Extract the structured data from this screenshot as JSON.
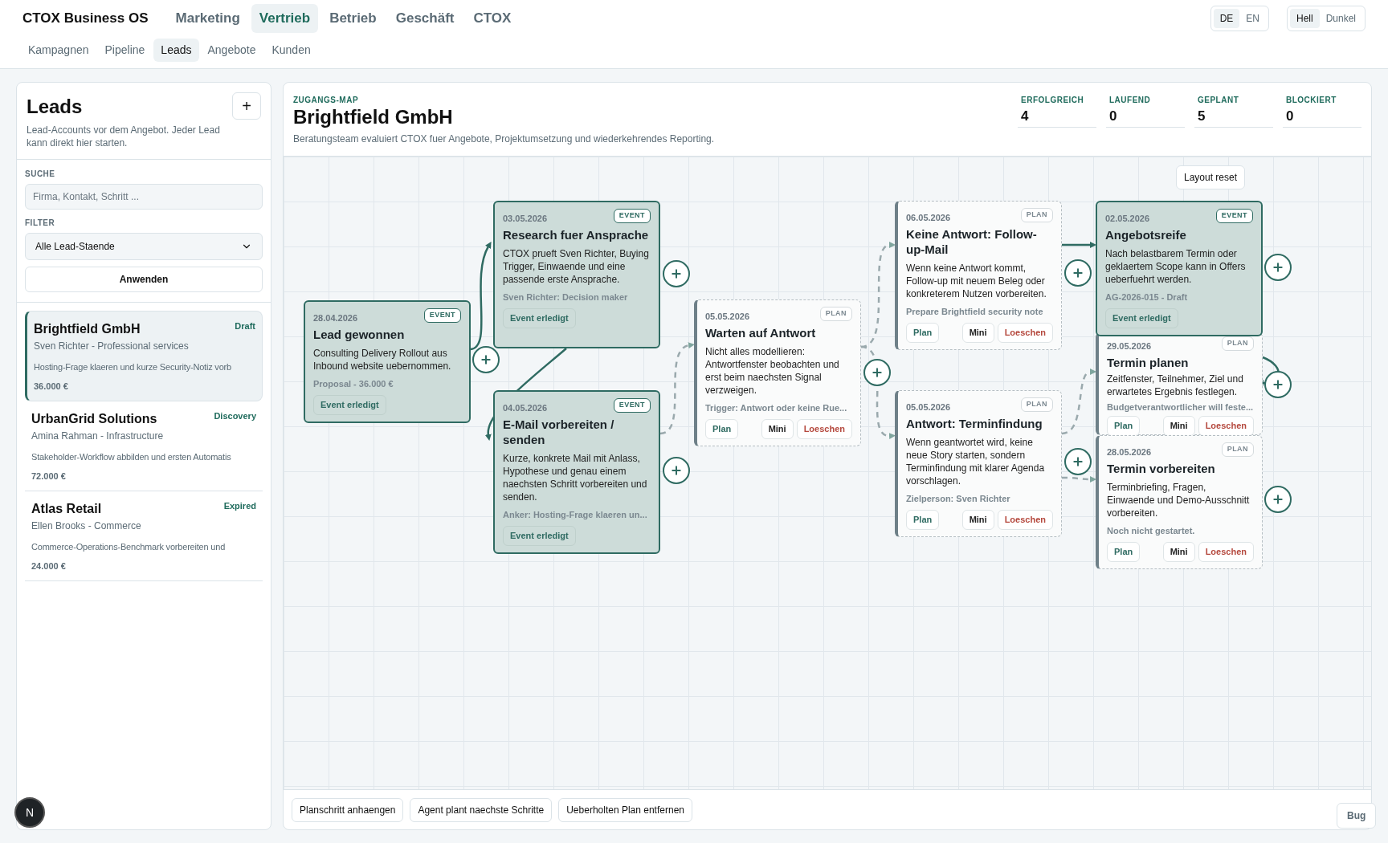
{
  "brand": "CTOX Business OS",
  "main_nav": [
    {
      "label": "Marketing",
      "selected": false
    },
    {
      "label": "Vertrieb",
      "selected": true
    },
    {
      "label": "Betrieb",
      "selected": false
    },
    {
      "label": "Geschäft",
      "selected": false
    },
    {
      "label": "CTOX",
      "selected": false
    }
  ],
  "sub_nav": [
    {
      "label": "Kampagnen",
      "selected": false
    },
    {
      "label": "Pipeline",
      "selected": false
    },
    {
      "label": "Leads",
      "selected": true
    },
    {
      "label": "Angebote",
      "selected": false
    },
    {
      "label": "Kunden",
      "selected": false
    }
  ],
  "language": [
    {
      "label": "DE",
      "selected": true
    },
    {
      "label": "EN",
      "selected": false
    }
  ],
  "theme": [
    {
      "label": "Hell",
      "selected": true
    },
    {
      "label": "Dunkel",
      "selected": false
    }
  ],
  "sidebar": {
    "title": "Leads",
    "add_button": "+",
    "subtitle": "Lead-Accounts vor dem Angebot. Jeder Lead kann direkt hier starten.",
    "search_label": "SUCHE",
    "search_placeholder": "Firma, Kontakt, Schritt ...",
    "filter_label": "FILTER",
    "filter_value": "Alle Lead-Staende",
    "apply_button": "Anwenden",
    "leads": [
      {
        "name": "Brightfield GmbH",
        "status": "Draft",
        "contact": "Sven Richter - Professional services",
        "next_step": "Hosting-Frage klaeren und kurze Security-Notiz vorb",
        "value": "36.000 €",
        "selected": true
      },
      {
        "name": "UrbanGrid Solutions",
        "status": "Discovery",
        "contact": "Amina Rahman - Infrastructure",
        "next_step": "Stakeholder-Workflow abbilden und ersten Automatis",
        "value": "72.000 €",
        "selected": false
      },
      {
        "name": "Atlas Retail",
        "status": "Expired",
        "contact": "Ellen Brooks - Commerce",
        "next_step": "Commerce-Operations-Benchmark vorbereiten und",
        "value": "24.000 €",
        "selected": false
      }
    ]
  },
  "map": {
    "eyebrow": "ZUGANGS-MAP",
    "title": "Brightfield GmbH",
    "description": "Beratungsteam evaluiert CTOX fuer Angebote, Projektumsetzung und wiederkehrendes Reporting.",
    "stats": [
      {
        "label": "ERFOLGREICH",
        "value": "4"
      },
      {
        "label": "LAUFEND",
        "value": "0"
      },
      {
        "label": "GEPLANT",
        "value": "5"
      },
      {
        "label": "BLOCKIERT",
        "value": "0"
      }
    ],
    "layout_reset": "Layout reset",
    "nodes": [
      {
        "kind": "event",
        "date": "28.04.2026",
        "badge": "EVENT",
        "title": "Lead gewonnen",
        "text": "Consulting Delivery Rollout aus Inbound website uebernommen.",
        "meta": "Proposal - 36.000 €",
        "actions": [
          {
            "kind": "done",
            "label": "Event erledigt"
          }
        ]
      },
      {
        "kind": "event",
        "date": "03.05.2026",
        "badge": "EVENT",
        "title": "Research fuer Ansprache",
        "text": "CTOX prueft Sven Richter, Buying Trigger, Einwaende und eine passende erste Ansprache.",
        "meta": "Sven Richter: Decision maker",
        "actions": [
          {
            "kind": "done",
            "label": "Event erledigt"
          }
        ]
      },
      {
        "kind": "event",
        "date": "04.05.2026",
        "badge": "EVENT",
        "title": "E-Mail vorbereiten / senden",
        "text": "Kurze, konkrete Mail mit Anlass, Hypothese und genau einem naechsten Schritt vorbereiten und senden.",
        "meta": "Anker: Hosting-Frage klaeren un...",
        "actions": [
          {
            "kind": "done",
            "label": "Event erledigt"
          }
        ]
      },
      {
        "kind": "plan",
        "date": "05.05.2026",
        "badge": "PLAN",
        "title": "Warten auf Antwort",
        "text": "Nicht alles modellieren: Antwortfenster beobachten und erst beim naechsten Signal verzweigen.",
        "meta": "Trigger: Antwort oder keine Rue...",
        "actions": [
          {
            "kind": "plan",
            "label": "Plan"
          },
          {
            "kind": "mini",
            "label": "Mini"
          },
          {
            "kind": "delete",
            "label": "Loeschen"
          }
        ]
      },
      {
        "kind": "plan",
        "date": "06.05.2026",
        "badge": "PLAN",
        "title": "Keine Antwort: Follow-up-Mail",
        "text": "Wenn keine Antwort kommt, Follow-up mit neuem Beleg oder konkreterem Nutzen vorbereiten.",
        "meta": "Prepare Brightfield security note",
        "actions": [
          {
            "kind": "plan",
            "label": "Plan"
          },
          {
            "kind": "mini",
            "label": "Mini"
          },
          {
            "kind": "delete",
            "label": "Loeschen"
          }
        ]
      },
      {
        "kind": "plan",
        "date": "05.05.2026",
        "badge": "PLAN",
        "title": "Antwort: Terminfindung",
        "text": "Wenn geantwortet wird, keine neue Story starten, sondern Terminfindung mit klarer Agenda vorschlagen.",
        "meta": "Zielperson: Sven Richter",
        "actions": [
          {
            "kind": "plan",
            "label": "Plan"
          },
          {
            "kind": "mini",
            "label": "Mini"
          },
          {
            "kind": "delete",
            "label": "Loeschen"
          }
        ]
      },
      {
        "kind": "event",
        "date": "02.05.2026",
        "badge": "EVENT",
        "title": "Angebotsreife",
        "text": "Nach belastbarem Termin oder geklaertem Scope kann in Offers ueberfuehrt werden.",
        "meta": "AG-2026-015 - Draft",
        "actions": [
          {
            "kind": "done",
            "label": "Event erledigt"
          }
        ]
      },
      {
        "kind": "plan",
        "date": "29.05.2026",
        "badge": "PLAN",
        "title": "Termin planen",
        "text": "Zeitfenster, Teilnehmer, Ziel und erwartetes Ergebnis festlegen.",
        "meta": "Budgetverantwortlicher will feste...",
        "actions": [
          {
            "kind": "plan",
            "label": "Plan"
          },
          {
            "kind": "mini",
            "label": "Mini"
          },
          {
            "kind": "delete",
            "label": "Loeschen"
          }
        ]
      },
      {
        "kind": "plan",
        "date": "28.05.2026",
        "badge": "PLAN",
        "title": "Termin vorbereiten",
        "text": "Terminbriefing, Fragen, Einwaende und Demo-Ausschnitt vorbereiten.",
        "meta": "Noch nicht gestartet.",
        "actions": [
          {
            "kind": "plan",
            "label": "Plan"
          },
          {
            "kind": "mini",
            "label": "Mini"
          },
          {
            "kind": "delete",
            "label": "Loeschen"
          }
        ]
      }
    ],
    "footer_buttons": [
      "Planschritt anhaengen",
      "Agent plant naechste Schritte",
      "Ueberholten Plan entfernen"
    ]
  },
  "avatar": "N",
  "bug_button": "Bug"
}
